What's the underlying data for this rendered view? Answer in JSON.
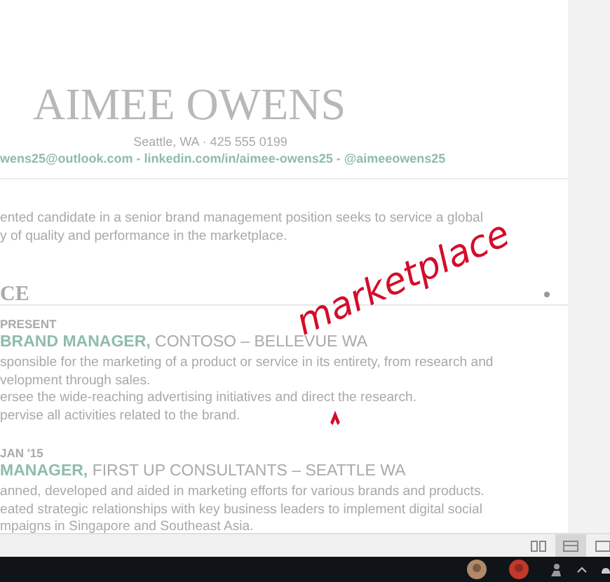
{
  "document": {
    "name": "AIMEE OWENS",
    "address": "Seattle, WA · 425 555 0199",
    "contact": "wens25@outlook.com - linkedin.com/in/aimee-owens25 - @aimeeowens25",
    "objective": [
      "ented candidate in a senior brand management position seeks to service a global",
      "y of quality and performance in the marketplace."
    ],
    "section": "CE",
    "jobs": [
      {
        "dates": "PRESENT",
        "title": "**BRAND MANAGER,** CONTOSO – BELLEVUE WA",
        "bullets": [
          "sponsible for the marketing of a product or service in its entirety, from research and",
          "velopment through sales.",
          "ersee the wide-reaching advertising initiatives and direct the research.",
          "pervise all activities related to the brand."
        ]
      },
      {
        "dates": "JAN '15",
        "title": "**MANAGER,** FIRST UP CONSULTANTS – SEATTLE WA",
        "bullets": [
          "anned, developed and aided in marketing efforts for various brands and products.",
          "eated strategic relationships with key business leaders to implement digital social",
          "mpaigns in Singapore and Southeast Asia."
        ]
      }
    ]
  },
  "ink": {
    "text": "marketplace",
    "color": "#d40d2a"
  },
  "status_bar": {
    "views": [
      {
        "kind": "read",
        "selected": false
      },
      {
        "kind": "print",
        "selected": true
      },
      {
        "kind": "web",
        "selected": false
      }
    ]
  }
}
